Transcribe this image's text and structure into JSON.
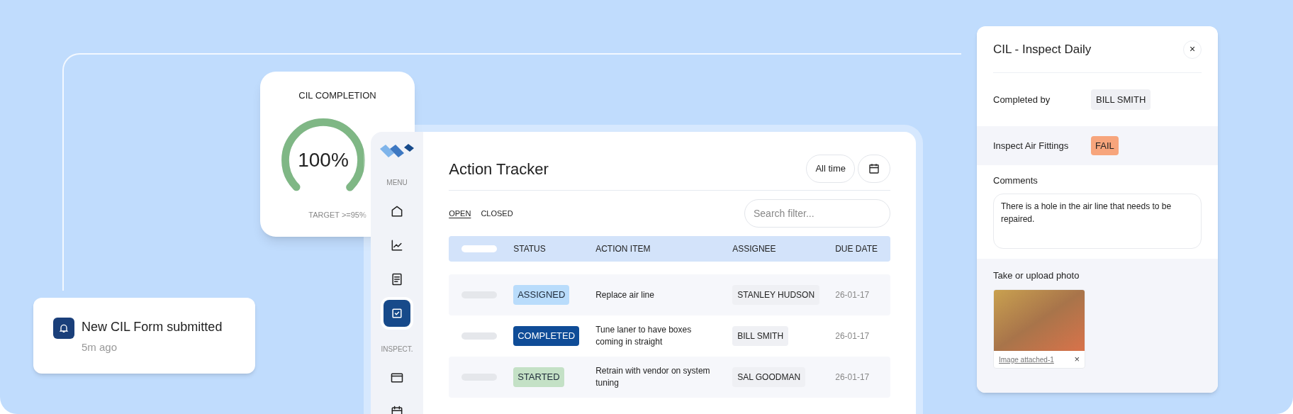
{
  "gauge_card": {
    "title": "CIL COMPLETION",
    "value": "100%",
    "level": 1,
    "target": "TARGET >=95%"
  },
  "notification": {
    "title": "New CIL Form submitted",
    "time": "5m ago"
  },
  "sidebar": {
    "sections": [
      {
        "label": "MENU",
        "items": [
          {
            "kind": "home",
            "selected": false
          },
          {
            "kind": "chart",
            "selected": false
          },
          {
            "kind": "document",
            "selected": false
          },
          {
            "kind": "checklist",
            "selected": true
          }
        ]
      },
      {
        "label": "INSPECT.",
        "items": [
          {
            "kind": "window",
            "selected": false
          },
          {
            "kind": "calendar",
            "selected": false
          }
        ]
      }
    ]
  },
  "action_tracker": {
    "title": "Action Tracker",
    "range_button": "All time",
    "tabs": [
      {
        "label": "OPEN",
        "selected": true
      },
      {
        "label": "CLOSED",
        "selected": false
      }
    ],
    "search": {
      "placeholder": "Search filter..."
    },
    "table": {
      "columns": [
        "STATUS",
        "ACTION ITEM",
        "ASSIGNEE",
        "DUE DATE"
      ],
      "rows": [
        {
          "status": "ASSIGNED",
          "kind": "light",
          "color": "#b9dcfb",
          "action": "Replace air line",
          "assignee": "STANLEY HUDSON",
          "due": "26-01-17"
        },
        {
          "status": "COMPLETED",
          "kind": "dark",
          "color": "#0f4c97",
          "action": "Tune laner to have boxes coming in straight",
          "assignee": "BILL SMITH",
          "due": "26-01-17"
        },
        {
          "status": "STARTED",
          "kind": "light",
          "color": "#c4e1c6",
          "action": "Retrain with vendor on system tuning",
          "assignee": "SAL GOODMAN",
          "due": "26-01-17"
        }
      ]
    }
  },
  "detail_panel": {
    "title": "CIL - Inspect Daily",
    "close": "×",
    "completed_by": {
      "label": "Completed by",
      "value": "BILL SMITH"
    },
    "check": {
      "label": "Inspect Air Fittings",
      "result": "FAIL",
      "color": "#f7a57c"
    },
    "comments": {
      "label": "Comments",
      "value": "There is a hole in the air line that needs to be repaired."
    },
    "photo": {
      "label": "Take or upload photo",
      "attachment": "Image attached-1",
      "remove": "×"
    }
  }
}
